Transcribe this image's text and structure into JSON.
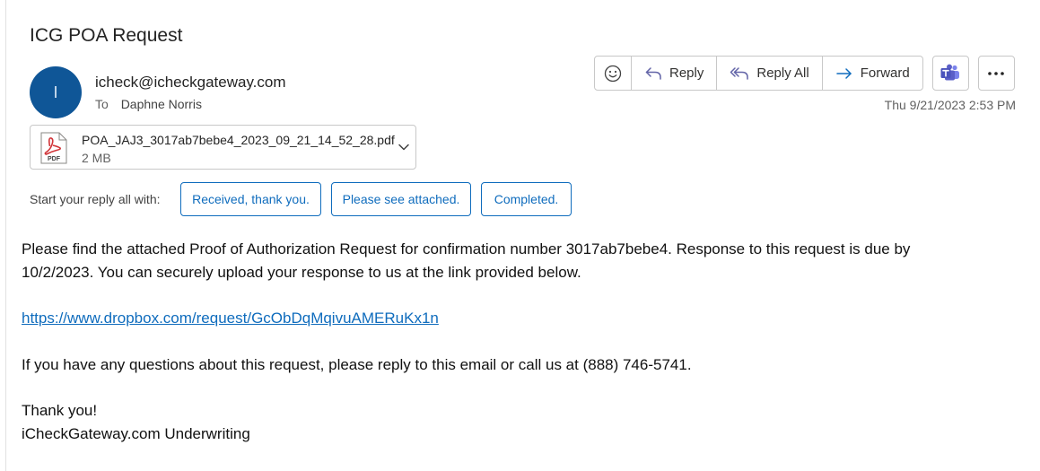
{
  "email": {
    "subject": "ICG POA Request",
    "avatar_initial": "I",
    "sender": "icheck@icheckgateway.com",
    "to_label": "To",
    "recipient": "Daphne Norris",
    "date": "Thu 9/21/2023 2:53 PM"
  },
  "toolbar": {
    "reply_label": "Reply",
    "reply_all_label": "Reply All",
    "forward_label": "Forward"
  },
  "attachment": {
    "file_name": "POA_JAJ3_3017ab7bebe4_2023_09_21_14_52_28.pdf",
    "file_size": "2 MB",
    "badge": "PDF"
  },
  "quick_reply": {
    "label": "Start your reply all with:",
    "options": [
      "Received, thank you.",
      "Please see attached.",
      "Completed."
    ]
  },
  "body": {
    "line1": "Please find the attached Proof of Authorization Request for confirmation number 3017ab7bebe4.  Response to this request is due by",
    "line2": "10/2/2023.  You can securely upload your response to us at the link provided below.",
    "link": "https://www.dropbox.com/request/GcObDqMqivuAMERuKx1n",
    "line3": "If you have any questions about this request, please reply to this email or call us at (888) 746-5741.",
    "closing": "Thank you!",
    "signature": "iCheckGateway.com Underwriting"
  },
  "colors": {
    "avatar": "#0f5697",
    "accent": "#0f6cbd",
    "pdf_red": "#d13438",
    "teams_purple": "#5b5fc7"
  }
}
